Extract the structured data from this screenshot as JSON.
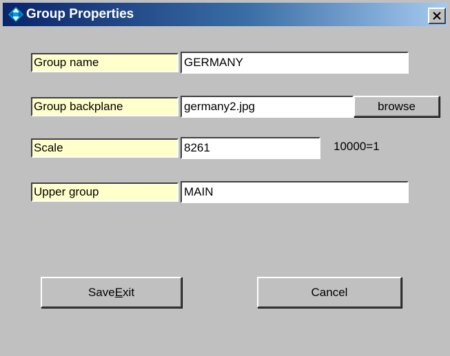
{
  "window": {
    "title": "Group Properties",
    "close_glyph": "✕",
    "title_icon": "diamond-arrows-icon"
  },
  "fields": {
    "group_name": {
      "label": "Group name",
      "value": "GERMANY"
    },
    "group_backplane": {
      "label": "Group backplane",
      "value": "germany2.jpg"
    },
    "scale": {
      "label": "Scale",
      "value": "8261",
      "note": "10000=1"
    },
    "upper_group": {
      "label": "Upper group",
      "value": "MAIN"
    }
  },
  "buttons": {
    "browse": "browse",
    "save_exit_prefix": "Save",
    "save_exit_mnemonic": "E",
    "save_exit_suffix": "xit",
    "cancel": "Cancel"
  },
  "colors": {
    "title_gradient_start": "#0a246a",
    "title_gradient_end": "#a6caf0",
    "label_background": "#ffffcc",
    "dialog_background": "#c0c0c0"
  }
}
